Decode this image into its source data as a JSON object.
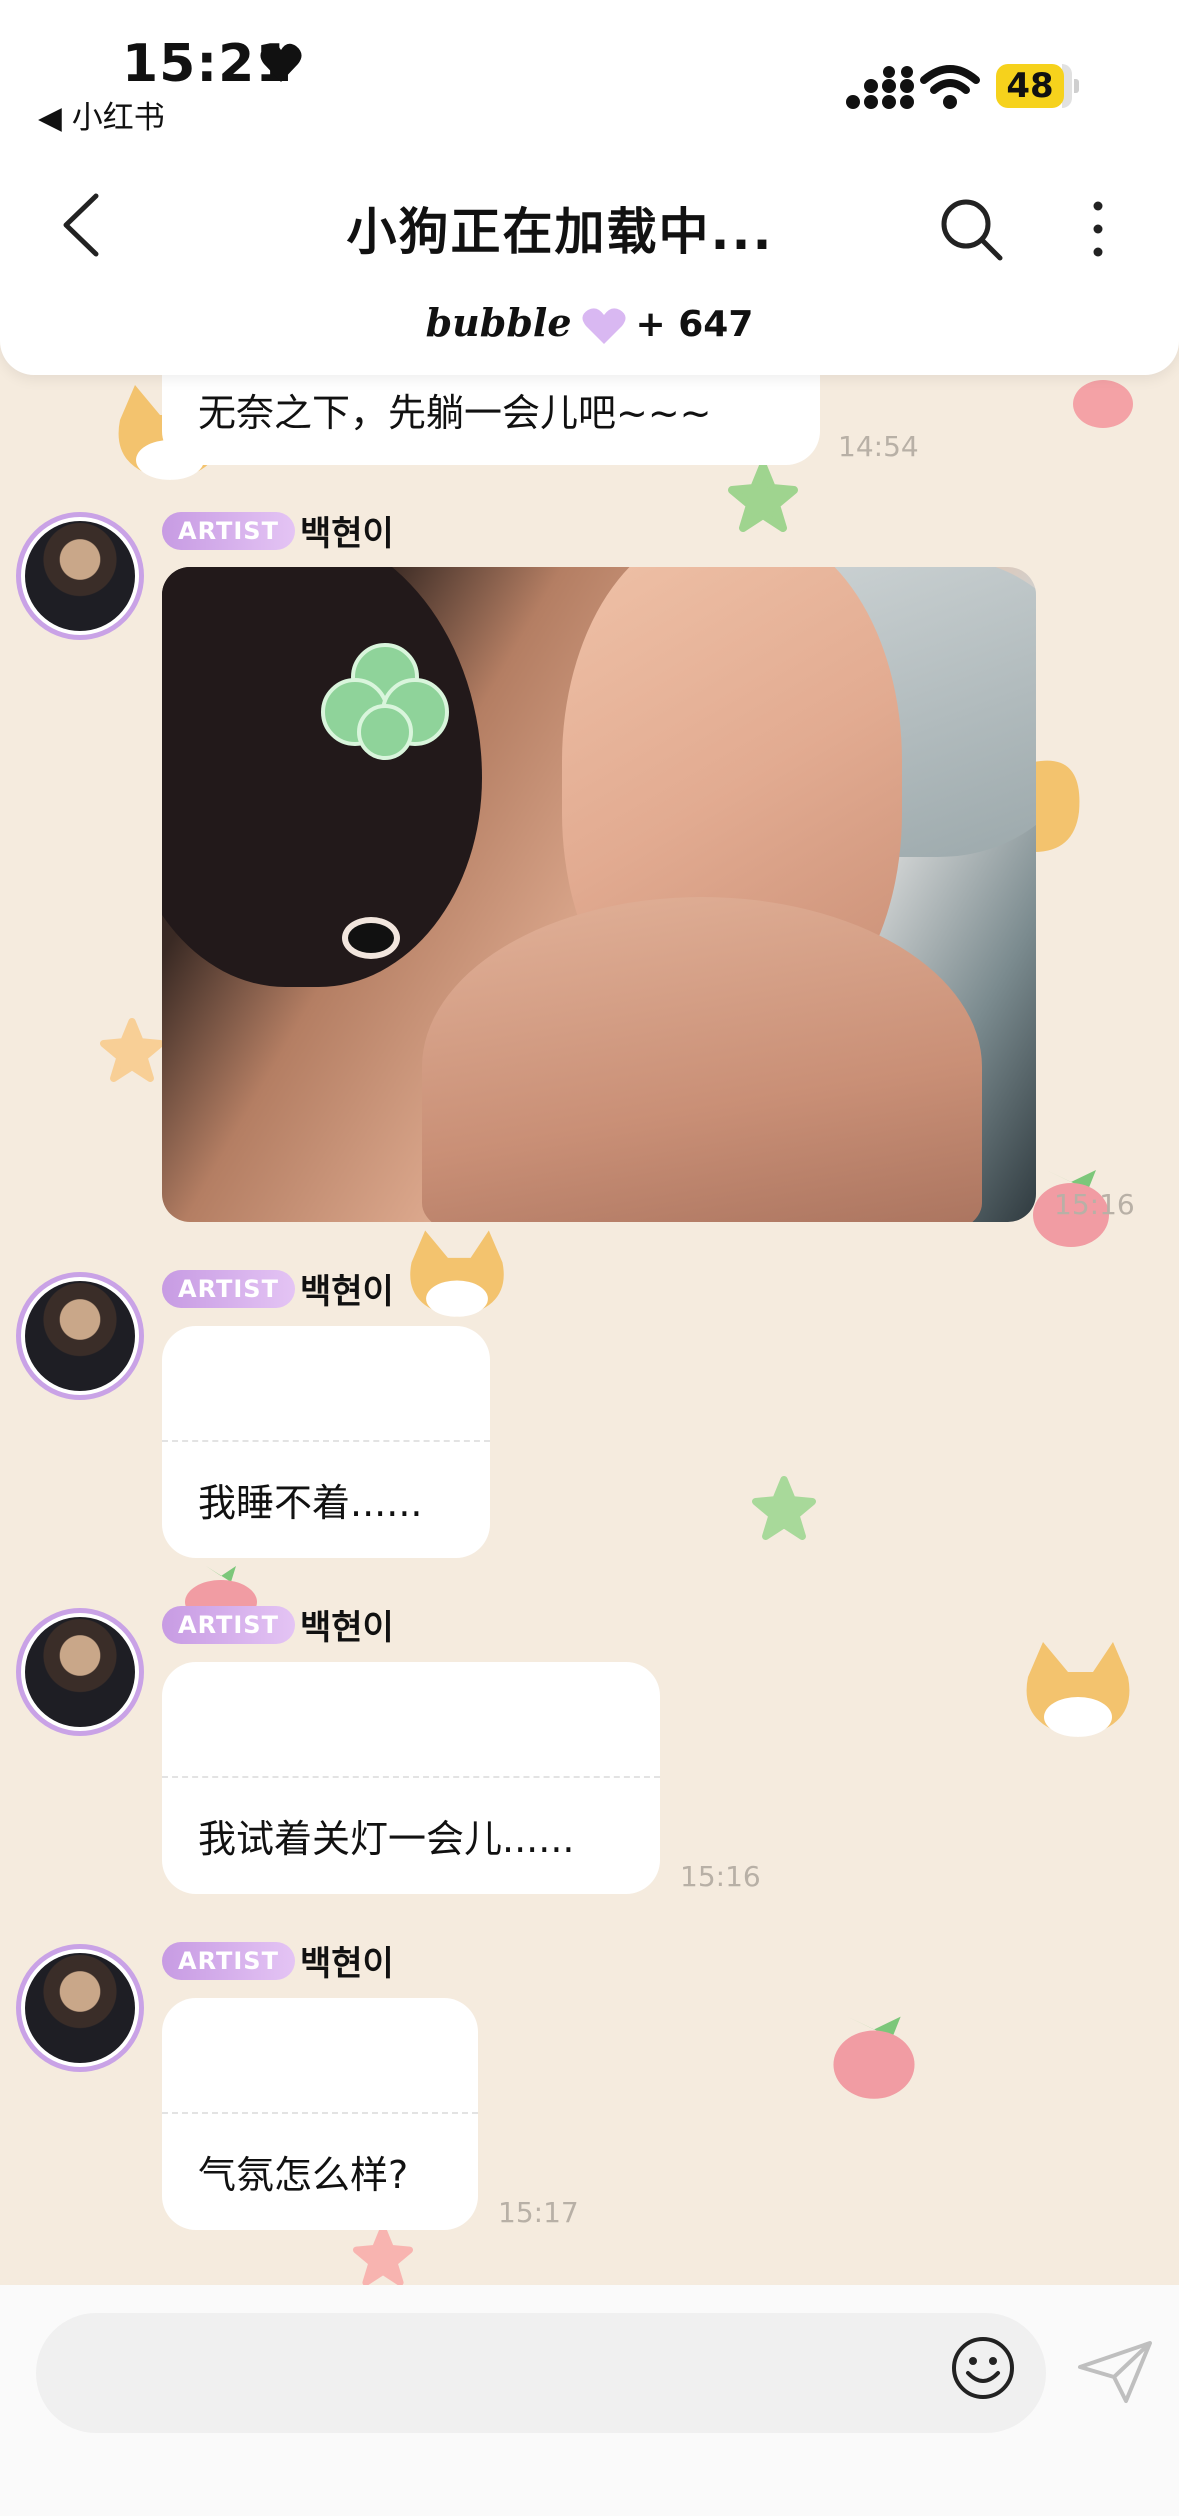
{
  "status_bar": {
    "time": "15:21",
    "back_app": "◀ 小红书",
    "battery": "48"
  },
  "header": {
    "title": "小狗正在加载中...",
    "bubble_word": "bubble",
    "bubble_count": "+ 647"
  },
  "messages": [
    {
      "text": "无奈之下，先躺一会儿吧~~~",
      "time": "14:54"
    },
    {
      "badge": "ARTIST",
      "sender": "백현이",
      "type": "image",
      "time": "15:16"
    },
    {
      "badge": "ARTIST",
      "sender": "백현이",
      "text": "我睡不着......",
      "time": ""
    },
    {
      "badge": "ARTIST",
      "sender": "백현이",
      "text": "我试着关灯一会儿......",
      "time": "15:16"
    },
    {
      "badge": "ARTIST",
      "sender": "백현이",
      "text": "气氛怎么样?",
      "time": "15:17"
    }
  ],
  "icons": {
    "back": "chevron-left-icon",
    "search": "search-icon",
    "more": "more-vertical-icon",
    "emoji": "smile-icon",
    "send": "send-icon"
  },
  "colors": {
    "chat_background": "#f5ebde",
    "artist_badge": "#c79be3",
    "battery": "#f6d21c"
  }
}
